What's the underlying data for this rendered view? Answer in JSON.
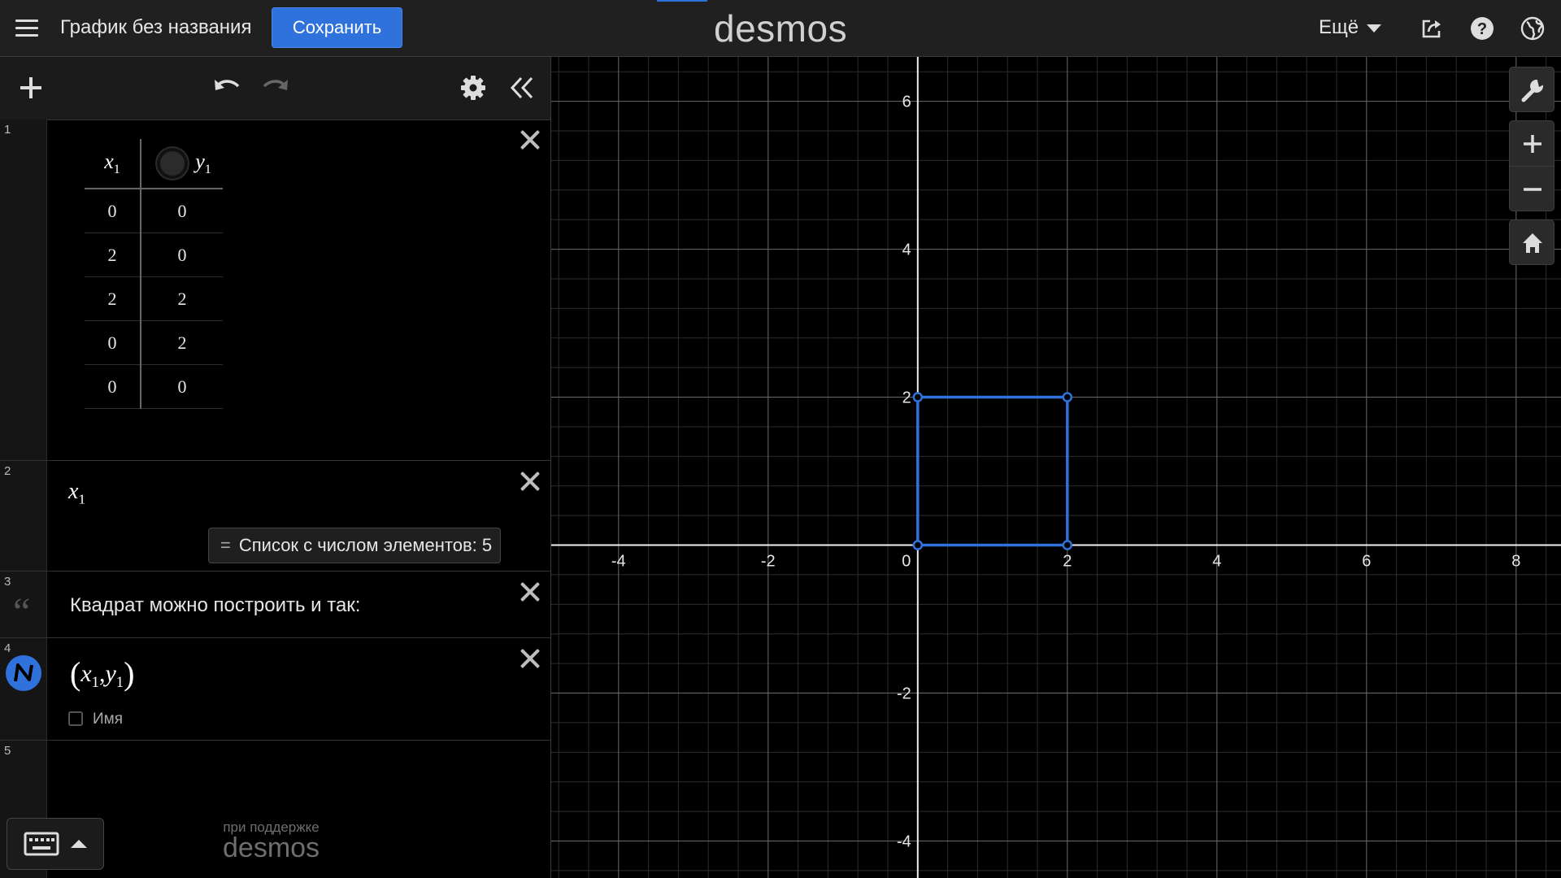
{
  "header": {
    "graph_title": "График без названия",
    "save_label": "Сохранить",
    "logo": "desmos",
    "more_label": "Ещё",
    "icons": [
      "hamburger-icon",
      "share-icon",
      "help-icon",
      "language-icon"
    ]
  },
  "panel": {
    "toolbar_icons": [
      "add-icon",
      "undo-icon",
      "redo-icon",
      "gear-icon",
      "collapse-icon"
    ],
    "expressions": [
      {
        "number": "1",
        "type": "table",
        "columns": [
          {
            "name": "x",
            "sub": "1"
          },
          {
            "name": "y",
            "sub": "1"
          }
        ],
        "rows": [
          [
            "0",
            "0"
          ],
          [
            "2",
            "0"
          ],
          [
            "2",
            "2"
          ],
          [
            "0",
            "2"
          ],
          [
            "0",
            "0"
          ]
        ]
      },
      {
        "number": "2",
        "type": "expression",
        "latex": {
          "name": "x",
          "sub": "1"
        },
        "result_label": "Список с числом элементов: 5"
      },
      {
        "number": "3",
        "type": "note",
        "text": "Квадрат можно построить и так:"
      },
      {
        "number": "4",
        "type": "expression",
        "expr": {
          "open": "(",
          "a": "x",
          "a_sub": "1",
          "sep": ",",
          "b": "y",
          "b_sub": "1",
          "close": ")"
        },
        "label_checkbox": "Имя",
        "color": "#2d70b3"
      },
      {
        "number": "5",
        "type": "empty"
      }
    ],
    "powered_small": "при поддержке",
    "powered_logo": "desmos"
  },
  "graph": {
    "x_ticks": [
      "-4",
      "-2",
      "0",
      "2",
      "4",
      "6",
      "8"
    ],
    "y_ticks": [
      "6",
      "4",
      "2",
      "-2",
      "-4"
    ],
    "polygon_color": "#2f72dc",
    "tool_icons": [
      "wrench-icon",
      "zoom-in-icon",
      "zoom-out-icon",
      "home-icon"
    ]
  },
  "chart_data": {
    "type": "line",
    "x": [
      0,
      2,
      2,
      0,
      0
    ],
    "series": [
      {
        "values": [
          0,
          0,
          2,
          2,
          0
        ]
      }
    ],
    "xlim": [
      -4.9,
      8.6
    ],
    "ylim": [
      -4.5,
      6.6
    ],
    "grid": true
  }
}
